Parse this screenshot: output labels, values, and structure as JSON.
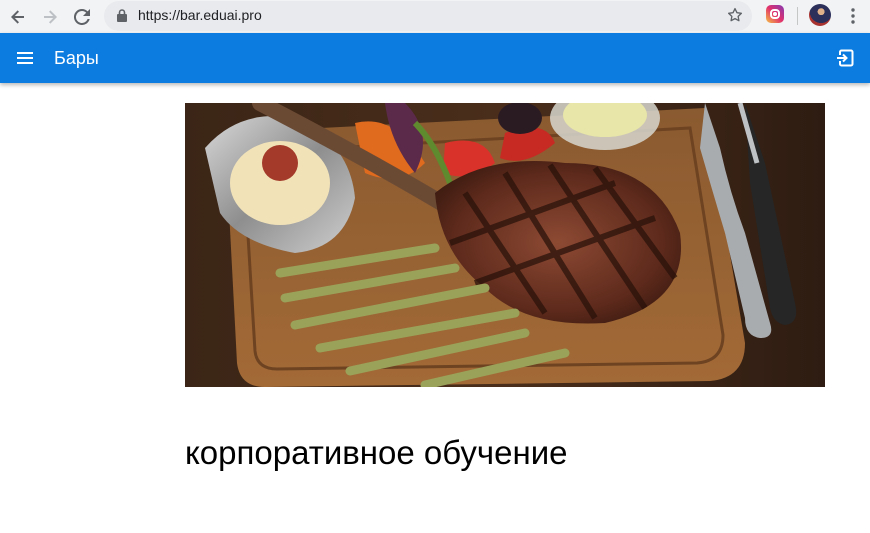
{
  "browser": {
    "url": "https://bar.eduai.pro",
    "back_icon": "arrow-left-icon",
    "forward_icon": "arrow-right-icon",
    "reload_icon": "reload-icon",
    "lock_icon": "lock-icon",
    "bookmark_icon": "star-icon",
    "extension_icon": "instagram-icon",
    "profile_icon": "avatar",
    "menu_icon": "kebab-menu-icon"
  },
  "app_bar": {
    "title": "Бары",
    "background": "#0d7ce0",
    "menu_icon": "hamburger-icon",
    "exit_icon": "logout-icon"
  },
  "main": {
    "hero_image": "steak-on-wooden-board-image",
    "heading": "корпоративное обучение"
  }
}
